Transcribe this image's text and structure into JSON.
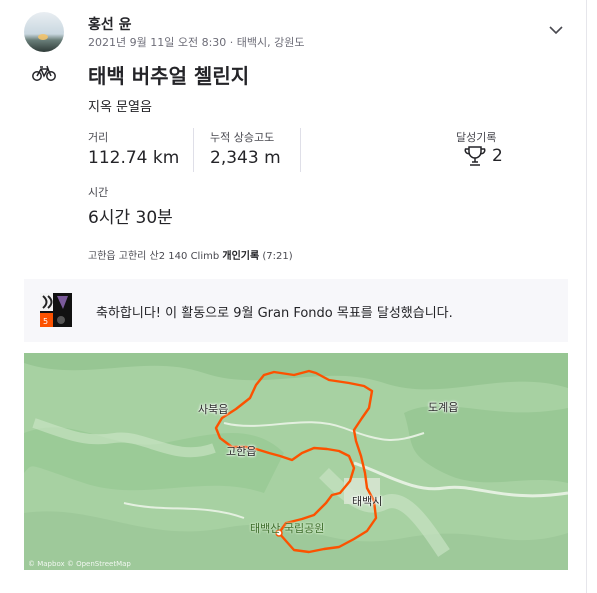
{
  "athlete": {
    "name": "홍선 윤",
    "meta": "2021년 9월 11일 오전 8:30 · 태백시, 강원도"
  },
  "activity": {
    "title": "태백 버추얼 첼린지",
    "description": "지옥 문열음",
    "stats": {
      "distance_label": "거리",
      "distance_value": "112.74 km",
      "elevation_label": "누적 상승고도",
      "elevation_value": "2,343 m",
      "achievements_label": "달성기록",
      "achievements_value": "2",
      "time_label": "시간",
      "time_value": "6시간 30분"
    },
    "segment": {
      "prefix": "고한읍 고한리 산2 140 Climb",
      "pr_label": "개인기록",
      "pr_time": "(7:21)"
    }
  },
  "banner": {
    "text": "축하합니다! 이 활동으로 9월 Gran Fondo 목표를 달성했습니다."
  },
  "map": {
    "towns": {
      "sabuk": "사북읍",
      "gohan": "고한읍",
      "dogye": "도계읍",
      "taebaek": "태백시"
    },
    "park": "태백산 국립공원",
    "attribution": "© Mapbox © OpenStreetMap",
    "route_color": "#fc5200"
  },
  "icons": {
    "bike": "bike-icon",
    "trophy": "trophy-icon",
    "menu": "chevron-down-icon"
  }
}
